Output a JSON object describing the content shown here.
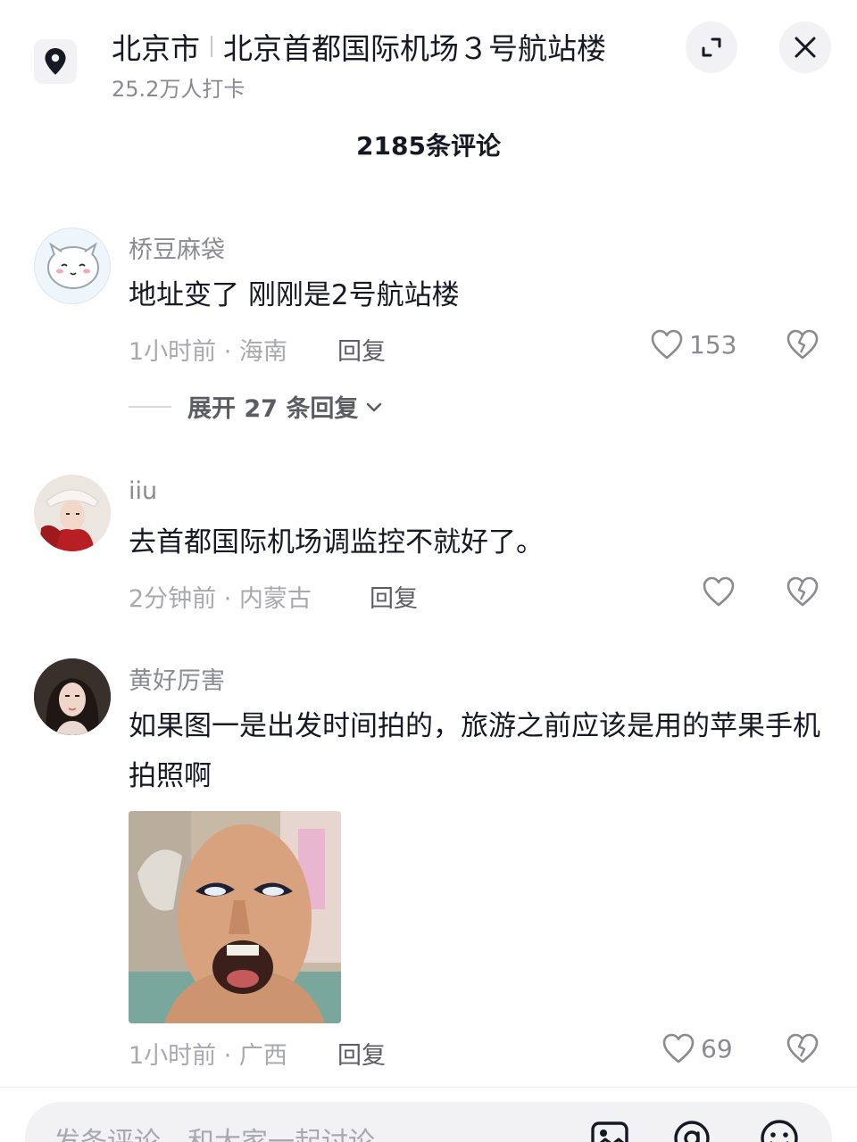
{
  "header": {
    "city": "北京市",
    "place": "北京首都国际机场３号航站楼",
    "checkins": "25.2万人打卡"
  },
  "comment_count": "2185条评论",
  "comments": [
    {
      "username": "桥豆麻袋",
      "text": "地址变了 刚刚是2号航站楼",
      "meta": "1小时前 · 海南",
      "reply": "回复",
      "likes": "153",
      "expand": "展开 27 条回复"
    },
    {
      "username": "iiu",
      "text": "去首都国际机场调监控不就好了。",
      "meta": "2分钟前 · 内蒙古",
      "reply": "回复",
      "likes": ""
    },
    {
      "username": "黄好厉害",
      "text": "如果图一是出发时间拍的，旅游之前应该是用的苹果手机拍照啊",
      "meta": "1小时前 · 广西",
      "reply": "回复",
      "likes": "69"
    }
  ],
  "bottom": {
    "placeholder": "发条评论，和大家一起讨论"
  },
  "icons": [
    "location-pin-icon",
    "expand-icon",
    "close-icon",
    "heart-icon",
    "broken-heart-icon",
    "chevron-down-icon",
    "image-icon",
    "at-icon",
    "emoji-icon"
  ]
}
